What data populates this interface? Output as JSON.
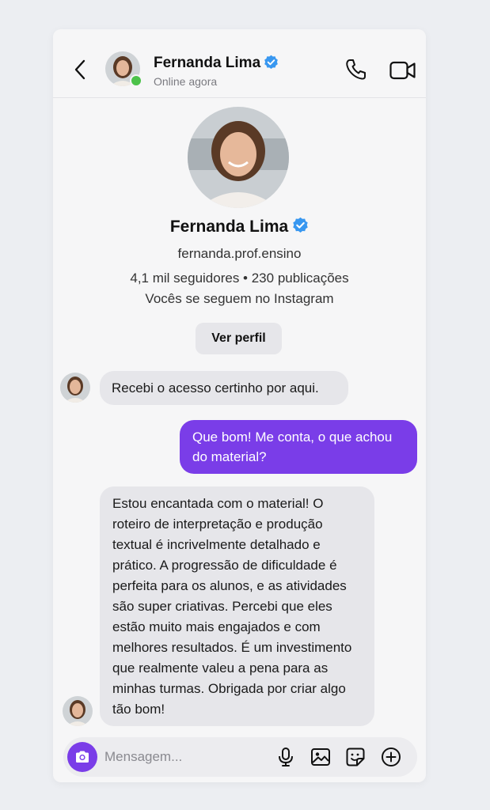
{
  "header": {
    "name": "Fernanda Lima",
    "status": "Online agora"
  },
  "profile": {
    "name": "Fernanda Lima",
    "handle": "fernanda.prof.ensino",
    "stats": "4,1 mil seguidores • 230 publicações",
    "follow_note": "Vocês se seguem no Instagram",
    "view_profile_label": "Ver perfil"
  },
  "messages": [
    {
      "from": "them",
      "text": "Recebi o acesso certinho por aqui."
    },
    {
      "from": "me",
      "text": "Que bom! Me conta, o que achou do material?"
    },
    {
      "from": "them",
      "text": "Estou encantada com o material! O roteiro de interpretação e produção textual é incrivelmente detalhado e prático. A progressão de dificuldade é perfeita para os alunos, e as atividades são super criativas. Percebi que eles estão muito mais engajados e com melhores resultados. É um investimento que realmente valeu a pena para as minhas turmas. Obrigada por criar algo tão bom!"
    }
  ],
  "composer": {
    "placeholder": "Mensagem...",
    "value": ""
  },
  "icons": {
    "back": "chevron-left-icon",
    "call": "phone-icon",
    "video": "video-camera-icon",
    "verified": "verified-badge-icon",
    "camera": "camera-icon",
    "mic": "microphone-icon",
    "gallery": "image-icon",
    "sticker": "sticker-icon",
    "plus": "plus-circle-icon"
  },
  "colors": {
    "accent": "#7a3de8",
    "verified": "#3897f0",
    "online": "#4cc24a",
    "incoming_bubble": "#e6e6ea"
  }
}
